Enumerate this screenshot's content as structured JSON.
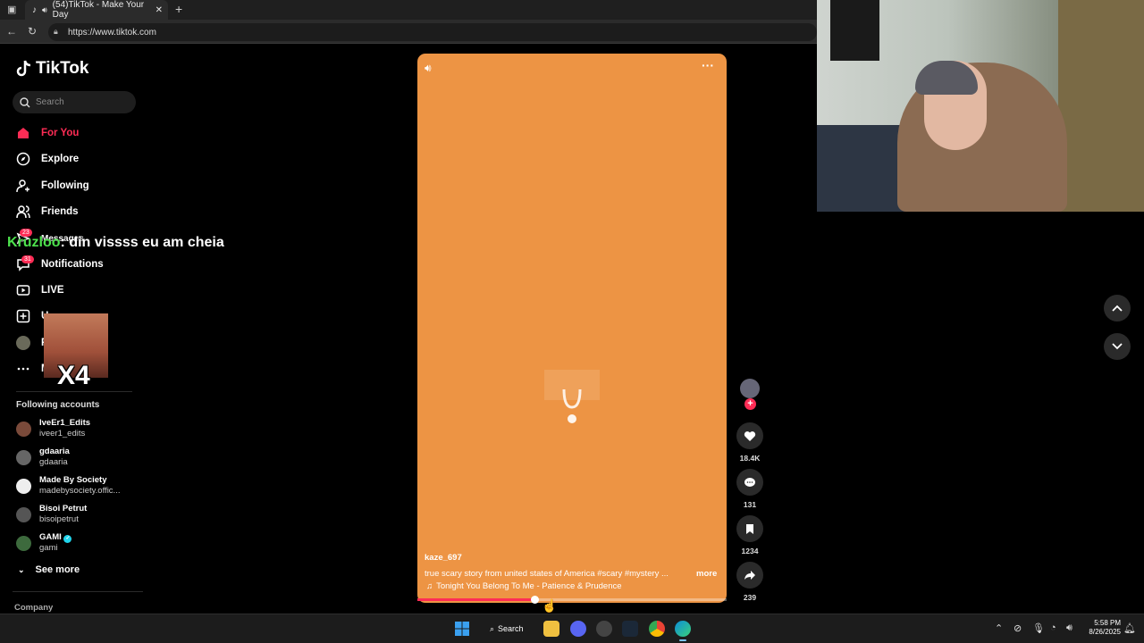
{
  "browser": {
    "tab_title": "(54)TikTok - Make Your Day",
    "url": "https://www.tiktok.com"
  },
  "sidebar": {
    "logo": "TikTok",
    "search_placeholder": "Search",
    "nav": [
      {
        "label": "For You",
        "icon": "home-icon",
        "active": true
      },
      {
        "label": "Explore",
        "icon": "compass-icon"
      },
      {
        "label": "Following",
        "icon": "following-icon"
      },
      {
        "label": "Friends",
        "icon": "friends-icon"
      },
      {
        "label": "Messages",
        "icon": "messages-icon",
        "badge": "23"
      },
      {
        "label": "Notifications",
        "icon": "notifications-icon",
        "badge": "31"
      },
      {
        "label": "LIVE",
        "icon": "live-icon"
      },
      {
        "label": "U",
        "icon": "upload-icon"
      },
      {
        "label": "P",
        "icon": "profile-icon"
      },
      {
        "label": "M",
        "icon": "more-icon"
      }
    ],
    "following_header": "Following accounts",
    "accounts": [
      {
        "name": "IveEr1_Edits",
        "handle": "iveer1_edits"
      },
      {
        "name": "gdaaria",
        "handle": "gdaaria"
      },
      {
        "name": "Made By Society",
        "handle": "madebysociety.offic..."
      },
      {
        "name": "Bisoi Petrut",
        "handle": "bisoipetrut"
      },
      {
        "name": "GAMI",
        "handle": "gami",
        "verified": true
      }
    ],
    "see_more": "See more",
    "company": "Company"
  },
  "overlay": {
    "chat_user": "Kruzloo",
    "chat_message": ": din vissss eu am cheia",
    "emote_count": "X4"
  },
  "video": {
    "background_color": "#ed9444",
    "author": "kaze_697",
    "caption": "true scary story from united states of America #scary  #mystery  ...",
    "more": "more",
    "music": "Tonight You Belong To Me - Patience & Prudence",
    "progress": 0.38
  },
  "actions": {
    "likes": "18.4K",
    "comments": "131",
    "saves": "1234",
    "shares": "239"
  },
  "taskbar": {
    "search": "Search",
    "time": "5:58 PM",
    "date": "8/26/2025"
  },
  "colors": {
    "accent": "#fe2c55",
    "chat_user": "#4de24d"
  }
}
